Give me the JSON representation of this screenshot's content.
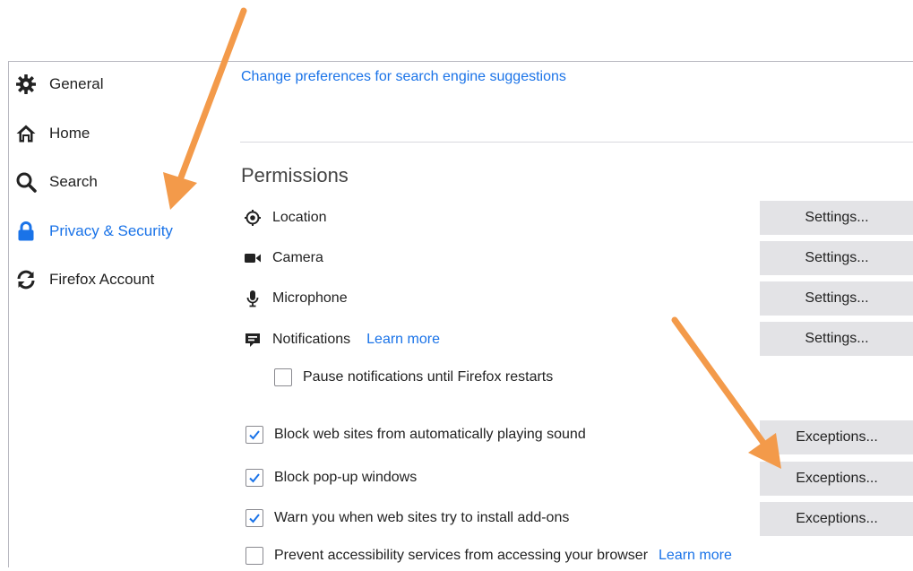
{
  "sidebar": {
    "items": [
      {
        "label": "General",
        "icon": "gear-icon"
      },
      {
        "label": "Home",
        "icon": "home-icon"
      },
      {
        "label": "Search",
        "icon": "search-icon"
      },
      {
        "label": "Privacy & Security",
        "icon": "lock-icon",
        "active": true
      },
      {
        "label": "Firefox Account",
        "icon": "sync-icon"
      }
    ]
  },
  "content": {
    "search_suggestions_link": "Change preferences for search engine suggestions",
    "permissions_title": "Permissions",
    "permissions": [
      {
        "label": "Location",
        "icon": "location-icon",
        "button": "Settings..."
      },
      {
        "label": "Camera",
        "icon": "camera-icon",
        "button": "Settings..."
      },
      {
        "label": "Microphone",
        "icon": "microphone-icon",
        "button": "Settings..."
      },
      {
        "label": "Notifications",
        "icon": "notifications-icon",
        "button": "Settings...",
        "learn_more": "Learn more"
      }
    ],
    "pause_notifications": {
      "label": "Pause notifications until Firefox restarts",
      "checked": false
    },
    "checkbox_rows": [
      {
        "label": "Block web sites from automatically playing sound",
        "checked": true,
        "button": "Exceptions..."
      },
      {
        "label": "Block pop-up windows",
        "checked": true,
        "button": "Exceptions..."
      },
      {
        "label": "Warn you when web sites try to install add-ons",
        "checked": true,
        "button": "Exceptions..."
      },
      {
        "label": "Prevent accessibility services from accessing your browser",
        "checked": false,
        "learn_more": "Learn more"
      }
    ]
  },
  "colors": {
    "accent": "#1a73e8",
    "button_bg": "#e3e3e6",
    "arrow": "#f39a4a"
  }
}
